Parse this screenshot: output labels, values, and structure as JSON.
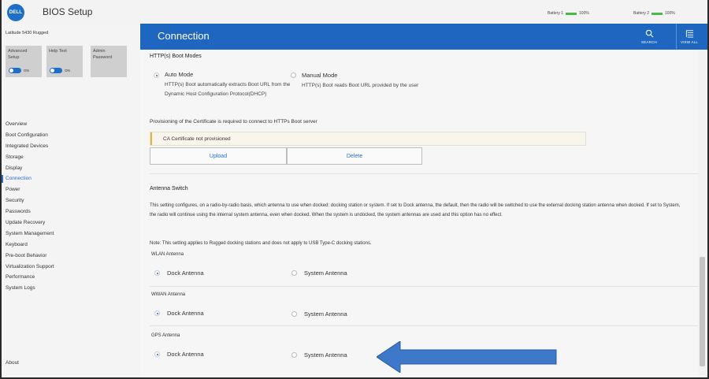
{
  "app": {
    "title": "BIOS Setup",
    "logo": "DELL"
  },
  "battery": [
    {
      "label": "Battery 1",
      "level": "100%"
    },
    {
      "label": "Battery 2",
      "level": "100%"
    }
  ],
  "sidebar": {
    "model": "Latitude 5430 Rugged",
    "options": [
      {
        "label": "Advanced Setup",
        "toggle": "ON"
      },
      {
        "label": "Help Text",
        "toggle": "ON"
      },
      {
        "label": "Admin Password"
      }
    ],
    "items": [
      {
        "label": "Overview"
      },
      {
        "label": "Boot Configuration"
      },
      {
        "label": "Integrated Devices"
      },
      {
        "label": "Storage"
      },
      {
        "label": "Display"
      },
      {
        "label": "Connection"
      },
      {
        "label": "Power"
      },
      {
        "label": "Security"
      },
      {
        "label": "Passwords"
      },
      {
        "label": "Update Recovery"
      },
      {
        "label": "System Management"
      },
      {
        "label": "Keyboard"
      },
      {
        "label": "Pre-boot Behavior"
      },
      {
        "label": "Virtualization Support"
      },
      {
        "label": "Performance"
      },
      {
        "label": "System Logs"
      }
    ],
    "active_item": "Connection",
    "about": "About"
  },
  "header": {
    "title": "Connection",
    "search_label": "SEARCH",
    "view_all_label": "VIEW ALL"
  },
  "http_boot": {
    "title": "HTTP(s) Boot Modes",
    "auto": {
      "label": "Auto Mode",
      "desc": "HTTP(s) Boot automatically extracts Boot URL from the Dynamic Host Configuration Protocol(DHCP)",
      "selected": true
    },
    "manual": {
      "label": "Manual Mode",
      "desc": "HTTP(s) Boot reads Boot URL provided by the user",
      "selected": false
    },
    "cert_note": "Provisioning of the Certificate is required to connect to HTTPs Boot server",
    "ca_status": "CA Certificate not provisioned",
    "upload_label": "Upload",
    "delete_label": "Delete"
  },
  "antenna": {
    "title": "Antenna Switch",
    "description": "This setting configures, on a radio-by-radio basis, which antenna to use when docked: docking station or system. If set to Dock antenna, the default, then the radio will be switched to use the external docking station antenna when docked. If set to System, the radio will continue using the internal system antenna, even when docked. When the system is undocked, the system antennas are used and this option has no effect.",
    "note": "Note: This setting applies to Rugged docking stations and does not apply to USB Type-C docking stations.",
    "groups": [
      {
        "title": "WLAN Antenna",
        "dock_label": "Dock Antenna",
        "system_label": "System Antenna",
        "selected": "dock"
      },
      {
        "title": "WWAN Antenna",
        "dock_label": "Dock Antenna",
        "system_label": "System Antenna",
        "selected": "dock"
      },
      {
        "title": "GPS Antenna",
        "dock_label": "Dock Antenna",
        "system_label": "System Antenna",
        "selected": "dock"
      }
    ]
  },
  "colors": {
    "header_blue": "#1f66c0",
    "accent_blue": "#1e6fc8",
    "battery_green": "#4cb848",
    "arrow_blue": "#3d78c9"
  }
}
